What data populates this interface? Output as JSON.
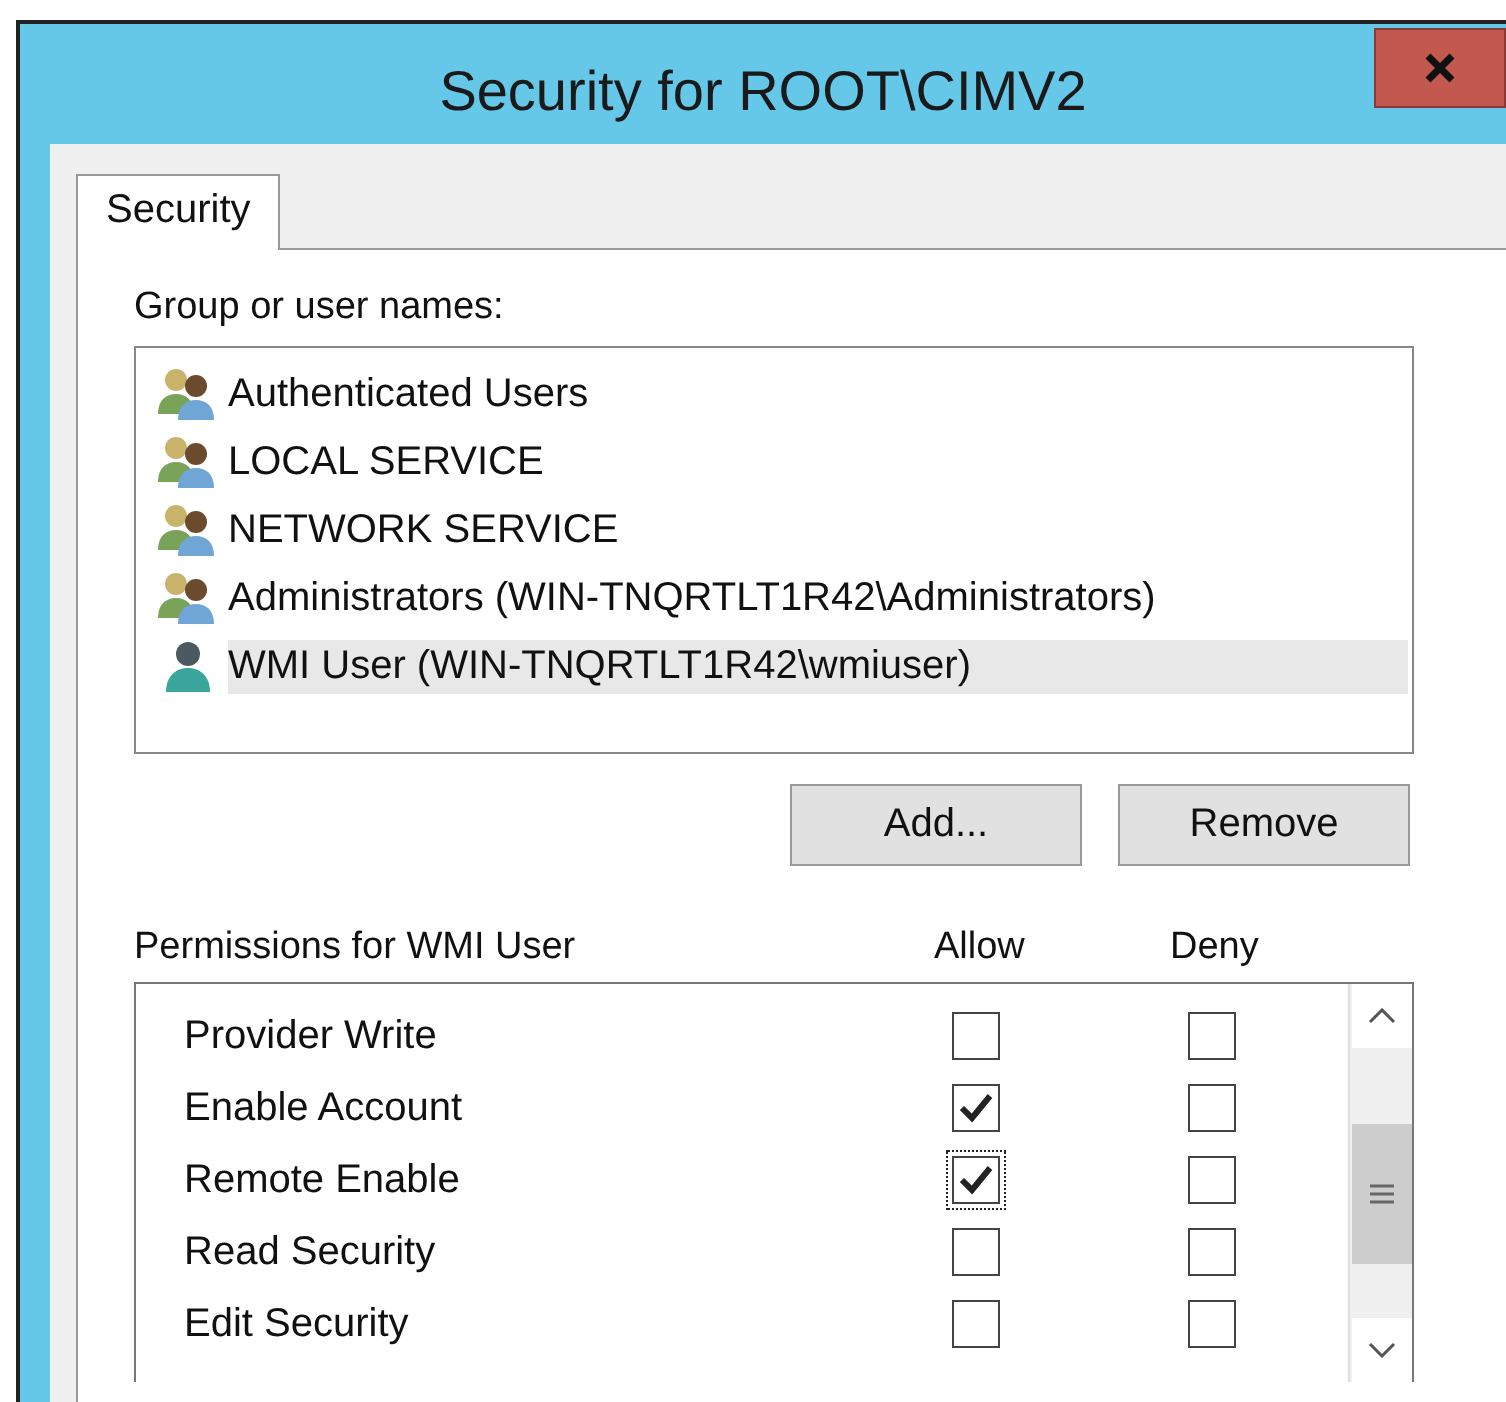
{
  "window": {
    "title": "Security for ROOT\\CIMV2"
  },
  "tabs": [
    {
      "label": "Security",
      "selected": true
    }
  ],
  "users_label": "Group or user names:",
  "users": [
    {
      "name": "Authenticated Users",
      "kind": "group",
      "selected": false
    },
    {
      "name": "LOCAL SERVICE",
      "kind": "group",
      "selected": false
    },
    {
      "name": "NETWORK SERVICE",
      "kind": "group",
      "selected": false
    },
    {
      "name": "Administrators (WIN-TNQRTLT1R42\\Administrators)",
      "kind": "group",
      "selected": false
    },
    {
      "name": "WMI User (WIN-TNQRTLT1R42\\wmiuser)",
      "kind": "user",
      "selected": true
    }
  ],
  "buttons": [
    "Add...",
    "Remove"
  ],
  "permissions_label": "Permissions for WMI User",
  "columns": [
    "Allow",
    "Deny"
  ],
  "permissions": [
    {
      "name": "Provider Write",
      "allow": false,
      "deny": false,
      "focused": false
    },
    {
      "name": "Enable Account",
      "allow": true,
      "deny": false,
      "focused": false
    },
    {
      "name": "Remote Enable",
      "allow": true,
      "deny": false,
      "focused": true
    },
    {
      "name": "Read Security",
      "allow": false,
      "deny": false,
      "focused": false
    },
    {
      "name": "Edit Security",
      "allow": false,
      "deny": false,
      "focused": false
    }
  ]
}
